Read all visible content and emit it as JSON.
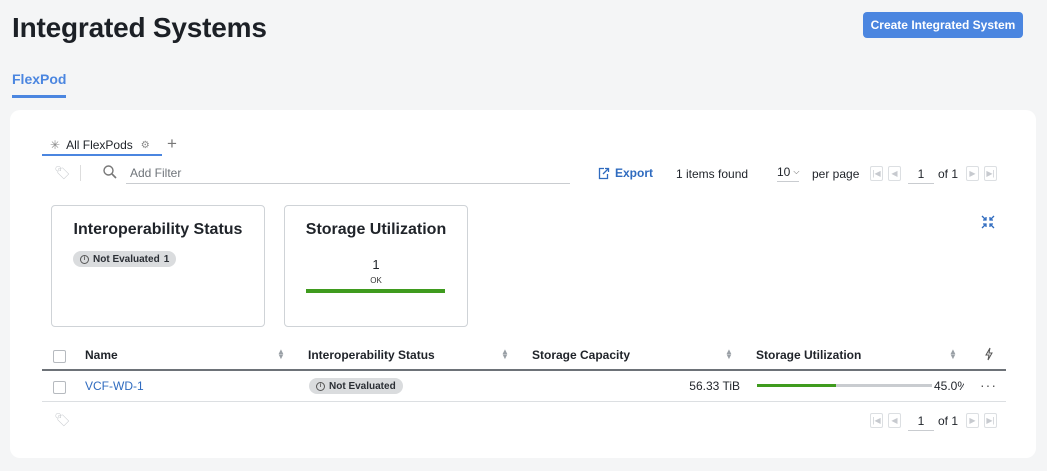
{
  "page": {
    "title": "Integrated Systems",
    "create_button": "Create Integrated System"
  },
  "tabs": {
    "active": "FlexPod"
  },
  "views": {
    "active": "All FlexPods",
    "add_symbol": "+"
  },
  "toolbar": {
    "filter_placeholder": "Add Filter",
    "export_label": "Export",
    "items_found": "1 items found",
    "per_page_value": "10",
    "per_page_label": "per page",
    "page_value": "1",
    "page_of": "of 1"
  },
  "widgets": {
    "interop": {
      "title": "Interoperability Status",
      "badge_label": "Not Evaluated",
      "badge_count": "1"
    },
    "storage": {
      "title": "Storage Utilization",
      "count": "1",
      "status": "OK"
    }
  },
  "table": {
    "columns": {
      "name": "Name",
      "interop": "Interoperability Status",
      "capacity": "Storage Capacity",
      "utilization": "Storage Utilization"
    },
    "rows": [
      {
        "name": "VCF-WD-1",
        "interop": "Not Evaluated",
        "capacity": "56.33 TiB",
        "utilization": "45.0%",
        "utilization_fraction": 0.45
      }
    ]
  },
  "footer": {
    "page_value": "1",
    "page_of": "of 1"
  },
  "colors": {
    "accent": "#4b86e0",
    "link": "#2f6bbf",
    "ok_green": "#3f9b1e",
    "badge_bg": "#dadcde"
  },
  "icons": [
    "tag-icon",
    "search-icon",
    "export-icon",
    "collapse-icon",
    "lightning-icon",
    "more-icon",
    "info-icon",
    "settings-icon"
  ]
}
